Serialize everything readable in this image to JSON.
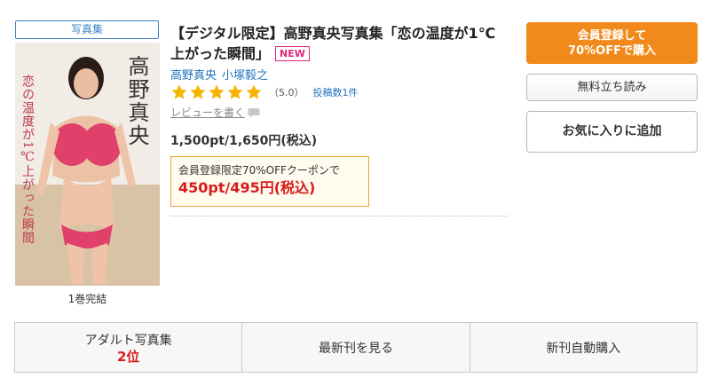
{
  "product": {
    "category_tag": "写真集",
    "cover_title": "高野真央",
    "cover_subtitle": "恋の温度が1℃上がった瞬間",
    "volume_note": "1巻完結",
    "title": "【デジタル限定】高野真央写真集「恋の温度が1℃上がった瞬間」",
    "new_badge": "NEW",
    "authors": [
      "高野真央",
      "小塚毅之"
    ],
    "rating": {
      "stars": 5,
      "score": "（5.0）",
      "count_text": "投稿数1件"
    },
    "review_link": "レビューを書く",
    "price": "1,500pt/1,650円(税込)",
    "coupon": {
      "label": "会員登録限定70%OFFクーポンで",
      "price": "450pt/495円(税込)"
    }
  },
  "actions": {
    "register_line1": "会員登録して",
    "register_line2": "70%OFFで購入",
    "trial": "無料立ち読み",
    "favorite": "お気に入りに追加"
  },
  "bottom_bar": {
    "ranking_label": "アダルト写真集",
    "ranking_value": "2位",
    "latest": "最新刊を見る",
    "auto_purchase": "新刊自動購入"
  },
  "colors": {
    "accent_orange": "#f28a1b",
    "link_blue": "#1e73be",
    "star_gold": "#f5b400",
    "price_red": "#d91a1a",
    "new_pink": "#e0267a"
  },
  "icons": {
    "star": "star-icon",
    "review": "speech-bubble-icon"
  }
}
